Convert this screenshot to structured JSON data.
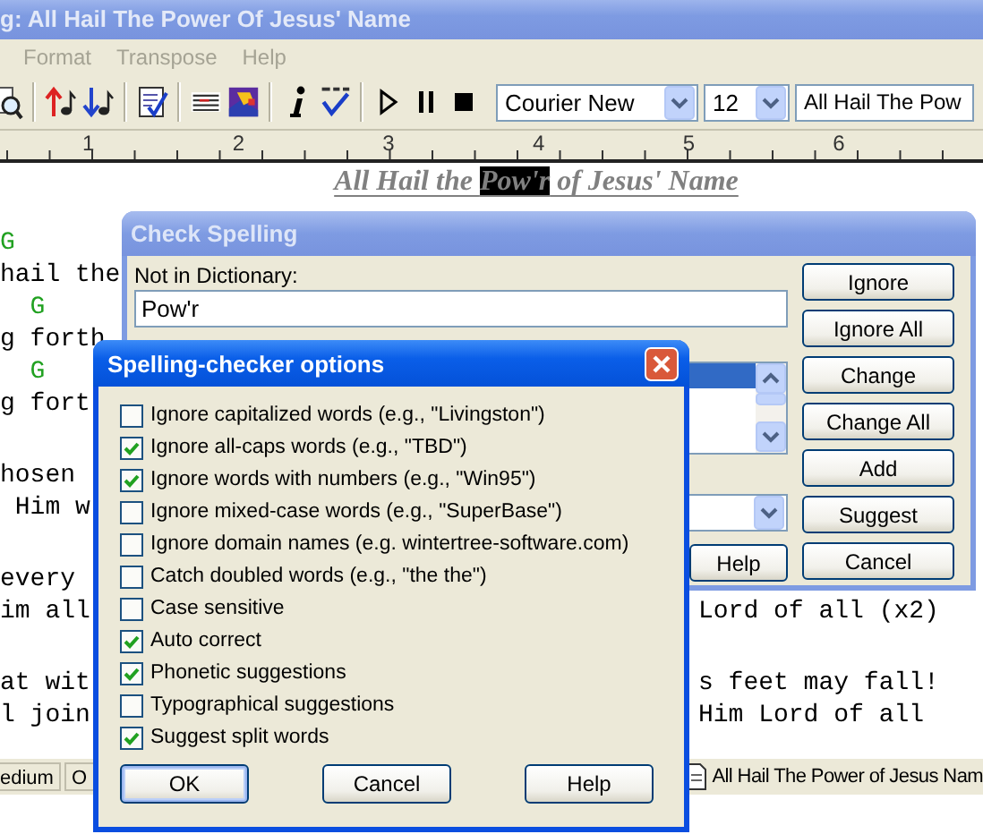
{
  "window": {
    "title": "g: All Hail The Power Of Jesus' Name"
  },
  "menu": [
    {
      "label": "Format",
      "disabled": true
    },
    {
      "label": "Transpose",
      "disabled": true
    },
    {
      "label": "Help",
      "disabled": true
    }
  ],
  "toolbar": {
    "groups": [
      {
        "tools": [
          {
            "kind": "preview"
          }
        ]
      },
      {
        "tools": [
          {
            "kind": "transpose-up"
          },
          {
            "kind": "transpose-down"
          }
        ]
      },
      {
        "tools": [
          {
            "kind": "checklist"
          }
        ]
      },
      {
        "tools": [
          {
            "kind": "lines"
          },
          {
            "kind": "image"
          }
        ]
      },
      {
        "tools": [
          {
            "kind": "info"
          },
          {
            "kind": "spell"
          }
        ]
      },
      {
        "tools": [
          {
            "kind": "play"
          },
          {
            "kind": "pause"
          },
          {
            "kind": "stop"
          }
        ]
      }
    ],
    "font": "Courier New",
    "size": "12",
    "song": "All Hail The Pow"
  },
  "ruler": [
    "1",
    "2",
    "3",
    "4",
    "5",
    "6"
  ],
  "song_title": [
    {
      "text": "All Hail the ",
      "selected": false
    },
    {
      "text": "Pow'r",
      "selected": true
    },
    {
      "text": " of Jesus' Name",
      "selected": false
    }
  ],
  "editor_lines": [
    {
      "kind": "chord",
      "left": "G"
    },
    {
      "kind": "lyric",
      "left": "hail the"
    },
    {
      "kind": "chord",
      "left": "  G"
    },
    {
      "kind": "lyric",
      "left": "g forth"
    },
    {
      "kind": "chord",
      "left": "  G"
    },
    {
      "kind": "lyric",
      "left": "g fort"
    },
    {
      "kind": "blank"
    },
    {
      "kind": "lyric",
      "left": "hosen"
    },
    {
      "kind": "lyric",
      "left": " Him w"
    },
    {
      "kind": "blank"
    },
    {
      "kind": "lyric",
      "left": "every"
    },
    {
      "kind": "lyric",
      "left": "im all",
      "right": "Lord of all (x2)"
    },
    {
      "kind": "blank"
    },
    {
      "kind": "lyric",
      "left": "at wit",
      "right": "s feet may fall!"
    },
    {
      "kind": "lyric",
      "left": "l join",
      "right": "Him Lord of all"
    }
  ],
  "status_bar": {
    "cells": [
      "edium",
      "O"
    ],
    "document": "All Hail The Power of Jesus Nam"
  },
  "check_spelling": {
    "title": "Check Spelling",
    "not_in_dictionary_label": "Not in Dictionary:",
    "word": "Pow'r",
    "buttons": [
      "Ignore",
      "Ignore All",
      "Change",
      "Change All",
      "Add",
      "Suggest",
      "Cancel"
    ],
    "help_button": "Help"
  },
  "options_dialog": {
    "title": "Spelling-checker options",
    "options": [
      {
        "label": "Ignore capitalized words (e.g., \"Livingston\")",
        "checked": false
      },
      {
        "label": "Ignore all-caps words (e.g., \"TBD\")",
        "checked": true
      },
      {
        "label": "Ignore words with numbers (e.g., \"Win95\")",
        "checked": true
      },
      {
        "label": "Ignore mixed-case words (e.g., \"SuperBase\")",
        "checked": false
      },
      {
        "label": "Ignore domain names (e.g. wintertree-software.com)",
        "checked": false
      },
      {
        "label": "Catch doubled words (e.g., \"the the\")",
        "checked": false
      },
      {
        "label": "Case sensitive",
        "checked": false
      },
      {
        "label": "Auto correct",
        "checked": true
      },
      {
        "label": "Phonetic suggestions",
        "checked": true
      },
      {
        "label": "Typographical suggestions",
        "checked": false
      },
      {
        "label": "Suggest split words",
        "checked": true
      }
    ],
    "buttons": [
      {
        "label": "OK",
        "default": true
      },
      {
        "label": "Cancel",
        "default": false
      },
      {
        "label": "Help",
        "default": false
      }
    ]
  }
}
